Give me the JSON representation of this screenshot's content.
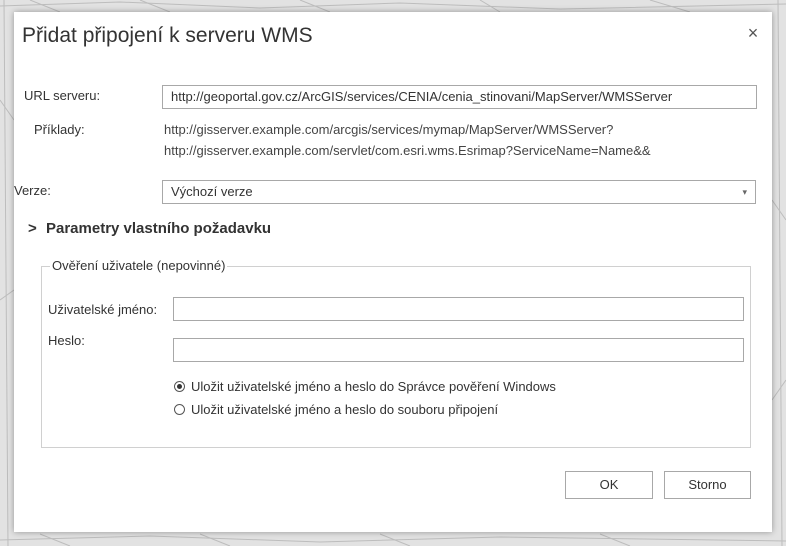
{
  "dialog": {
    "title": "Přidat připojení k serveru WMS",
    "close_glyph": "×"
  },
  "server_url": {
    "label": "URL serveru:",
    "value": "http://geoportal.gov.cz/ArcGIS/services/CENIA/cenia_stinovani/MapServer/WMSServer"
  },
  "examples": {
    "label": "Příklady:",
    "lines": [
      "http://gisserver.example.com/arcgis/services/mymap/MapServer/WMSServer?",
      "http://gisserver.example.com/servlet/com.esri.wms.Esrimap?ServiceName=Name&&"
    ]
  },
  "version": {
    "label": "Verze:",
    "selected": "Výchozí verze",
    "arrow_glyph": "▾"
  },
  "custom_params": {
    "label": "Parametry vlastního požadavku",
    "chevron_glyph": ">"
  },
  "auth": {
    "legend": "Ověření uživatele (nepovinné)",
    "username_label": "Uživatelské jméno:",
    "username_value": "",
    "password_label": "Heslo:",
    "password_value": "",
    "options": [
      {
        "label": "Uložit uživatelské jméno a heslo do Správce pověření Windows",
        "selected": true
      },
      {
        "label": "Uložit uživatelské jméno a heslo do souboru připojení",
        "selected": false
      }
    ]
  },
  "buttons": {
    "ok": "OK",
    "cancel": "Storno"
  },
  "icons": [
    "close-icon",
    "chevron-right-icon",
    "dropdown-arrow-icon"
  ]
}
